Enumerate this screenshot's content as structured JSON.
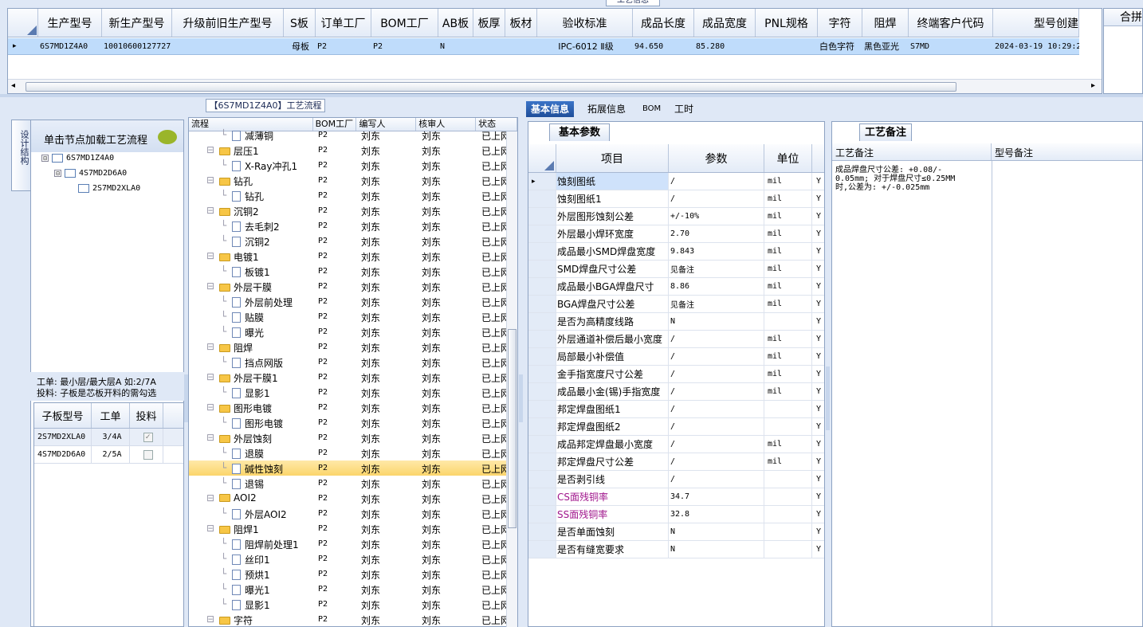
{
  "top_grid": {
    "top_label": "工艺信息",
    "columns": [
      "生产型号",
      "新生产型号",
      "升级前旧生产型号",
      "S板",
      "订单工厂",
      "BOM工厂",
      "AB板",
      "板厚",
      "板材",
      "验收标准",
      "成品长度",
      "成品宽度",
      "PNL规格",
      "字符",
      "阻焊",
      "终端客户代码",
      "型号创建"
    ],
    "row": {
      "marker": "▸",
      "cells": [
        "6S7MD1Z4A0",
        "10010600127727",
        "",
        "母板",
        "P2",
        "P2",
        "N",
        "",
        "",
        "IPC-6012 Ⅱ级",
        "94.650",
        "85.280",
        "",
        "白色字符",
        "黑色亚光",
        "S7MD",
        "2024-03-19 10:29:2"
      ]
    },
    "merge_label": "合拼"
  },
  "left": {
    "side_tab": "设计结构",
    "header": "单击节点加载工艺流程",
    "tree": [
      {
        "pm": "⊟",
        "label": "6S7MD1Z4A0"
      },
      {
        "pm": "⊟",
        "label": "4S7MD2D6A0"
      },
      {
        "pm": "",
        "label": "2S7MD2XLA0"
      }
    ],
    "note_line1": "工单: 最小层/最大层A 如:2/7A",
    "note_line2": "投料: 子板是芯板开料的需勾选",
    "subgrid": {
      "headers": [
        "子板型号",
        "工单",
        "投料"
      ],
      "rows": [
        {
          "model": "2S7MD2XLA0",
          "order": "3/4A",
          "checked": true,
          "mark": "✓"
        },
        {
          "model": "4S7MD2D6A0",
          "order": "2/5A",
          "checked": false,
          "mark": ""
        }
      ]
    }
  },
  "process": {
    "title": "【6S7MD1Z4A0】工艺流程",
    "headers": [
      "流程",
      "BOM工厂",
      "编写人",
      "核审人",
      "状态"
    ],
    "rows": [
      {
        "name": "减薄铜",
        "folder": false,
        "bom": "P2",
        "writer": "刘东",
        "reviewer": "刘东",
        "status": "已上网"
      },
      {
        "name": "层压1",
        "folder": true,
        "bom": "P2",
        "writer": "刘东",
        "reviewer": "刘东",
        "status": "已上网"
      },
      {
        "name": "X-Ray冲孔1",
        "folder": false,
        "bom": "P2",
        "writer": "刘东",
        "reviewer": "刘东",
        "status": "已上网"
      },
      {
        "name": "钻孔",
        "folder": true,
        "bom": "P2",
        "writer": "刘东",
        "reviewer": "刘东",
        "status": "已上网"
      },
      {
        "name": "钻孔",
        "folder": false,
        "bom": "P2",
        "writer": "刘东",
        "reviewer": "刘东",
        "status": "已上网"
      },
      {
        "name": "沉铜2",
        "folder": true,
        "bom": "P2",
        "writer": "刘东",
        "reviewer": "刘东",
        "status": "已上网"
      },
      {
        "name": "去毛刺2",
        "folder": false,
        "bom": "P2",
        "writer": "刘东",
        "reviewer": "刘东",
        "status": "已上网"
      },
      {
        "name": "沉铜2",
        "folder": false,
        "bom": "P2",
        "writer": "刘东",
        "reviewer": "刘东",
        "status": "已上网"
      },
      {
        "name": "电镀1",
        "folder": true,
        "bom": "P2",
        "writer": "刘东",
        "reviewer": "刘东",
        "status": "已上网"
      },
      {
        "name": "板镀1",
        "folder": false,
        "bom": "P2",
        "writer": "刘东",
        "reviewer": "刘东",
        "status": "已上网"
      },
      {
        "name": "外层干膜",
        "folder": true,
        "bom": "P2",
        "writer": "刘东",
        "reviewer": "刘东",
        "status": "已上网"
      },
      {
        "name": "外层前处理",
        "folder": false,
        "bom": "P2",
        "writer": "刘东",
        "reviewer": "刘东",
        "status": "已上网"
      },
      {
        "name": "贴膜",
        "folder": false,
        "bom": "P2",
        "writer": "刘东",
        "reviewer": "刘东",
        "status": "已上网"
      },
      {
        "name": "曝光",
        "folder": false,
        "bom": "P2",
        "writer": "刘东",
        "reviewer": "刘东",
        "status": "已上网"
      },
      {
        "name": "阻焊",
        "folder": true,
        "bom": "P2",
        "writer": "刘东",
        "reviewer": "刘东",
        "status": "已上网"
      },
      {
        "name": "挡点网版",
        "folder": false,
        "bom": "P2",
        "writer": "刘东",
        "reviewer": "刘东",
        "status": "已上网"
      },
      {
        "name": "外层干膜1",
        "folder": true,
        "bom": "P2",
        "writer": "刘东",
        "reviewer": "刘东",
        "status": "已上网"
      },
      {
        "name": "显影1",
        "folder": false,
        "bom": "P2",
        "writer": "刘东",
        "reviewer": "刘东",
        "status": "已上网"
      },
      {
        "name": "图形电镀",
        "folder": true,
        "bom": "P2",
        "writer": "刘东",
        "reviewer": "刘东",
        "status": "已上网"
      },
      {
        "name": "图形电镀",
        "folder": false,
        "bom": "P2",
        "writer": "刘东",
        "reviewer": "刘东",
        "status": "已上网"
      },
      {
        "name": "外层蚀刻",
        "folder": true,
        "bom": "P2",
        "writer": "刘东",
        "reviewer": "刘东",
        "status": "已上网"
      },
      {
        "name": "退膜",
        "folder": false,
        "bom": "P2",
        "writer": "刘东",
        "reviewer": "刘东",
        "status": "已上网"
      },
      {
        "name": "碱性蚀刻",
        "folder": false,
        "bom": "P2",
        "writer": "刘东",
        "reviewer": "刘东",
        "status": "已上网",
        "selected": true
      },
      {
        "name": "退锡",
        "folder": false,
        "bom": "P2",
        "writer": "刘东",
        "reviewer": "刘东",
        "status": "已上网"
      },
      {
        "name": "AOI2",
        "folder": true,
        "bom": "P2",
        "writer": "刘东",
        "reviewer": "刘东",
        "status": "已上网"
      },
      {
        "name": "外层AOI2",
        "folder": false,
        "bom": "P2",
        "writer": "刘东",
        "reviewer": "刘东",
        "status": "已上网"
      },
      {
        "name": "阻焊1",
        "folder": true,
        "bom": "P2",
        "writer": "刘东",
        "reviewer": "刘东",
        "status": "已上网"
      },
      {
        "name": "阻焊前处理1",
        "folder": false,
        "bom": "P2",
        "writer": "刘东",
        "reviewer": "刘东",
        "status": "已上网"
      },
      {
        "name": "丝印1",
        "folder": false,
        "bom": "P2",
        "writer": "刘东",
        "reviewer": "刘东",
        "status": "已上网"
      },
      {
        "name": "预烘1",
        "folder": false,
        "bom": "P2",
        "writer": "刘东",
        "reviewer": "刘东",
        "status": "已上网"
      },
      {
        "name": "曝光1",
        "folder": false,
        "bom": "P2",
        "writer": "刘东",
        "reviewer": "刘东",
        "status": "已上网"
      },
      {
        "name": "显影1",
        "folder": false,
        "bom": "P2",
        "writer": "刘东",
        "reviewer": "刘东",
        "status": "已上网"
      },
      {
        "name": "字符",
        "folder": true,
        "bom": "P2",
        "writer": "刘东",
        "reviewer": "刘东",
        "status": "已上网"
      }
    ]
  },
  "tabs": [
    "基本信息",
    "拓展信息",
    "BOM",
    "工时"
  ],
  "basic": {
    "subtab": "基本参数",
    "headers": [
      "项目",
      "参数",
      "单位"
    ],
    "rows": [
      {
        "item": "蚀刻图纸",
        "value": "/",
        "unit": "mil",
        "flag": "Y",
        "marker": "▸",
        "highlight": true
      },
      {
        "item": "蚀刻图纸1",
        "value": "/",
        "unit": "mil",
        "flag": "Y"
      },
      {
        "item": "外层图形蚀刻公差",
        "value": "+/-10%",
        "unit": "mil",
        "flag": "Y"
      },
      {
        "item": "外层最小焊环宽度",
        "value": "2.70",
        "unit": "mil",
        "flag": "Y"
      },
      {
        "item": "成品最小SMD焊盘宽度",
        "value": "9.843",
        "unit": "mil",
        "flag": "Y"
      },
      {
        "item": "SMD焊盘尺寸公差",
        "value": "见备注",
        "unit": "mil",
        "flag": "Y"
      },
      {
        "item": "成品最小BGA焊盘尺寸",
        "value": "8.86",
        "unit": "mil",
        "flag": "Y"
      },
      {
        "item": "BGA焊盘尺寸公差",
        "value": "见备注",
        "unit": "mil",
        "flag": "Y"
      },
      {
        "item": "是否为高精度线路",
        "value": "N",
        "unit": "",
        "flag": "Y"
      },
      {
        "item": "外层通道补偿后最小宽度",
        "value": "/",
        "unit": "mil",
        "flag": "Y"
      },
      {
        "item": "局部最小补偿值",
        "value": "/",
        "unit": "mil",
        "flag": "Y"
      },
      {
        "item": "金手指宽度尺寸公差",
        "value": "/",
        "unit": "mil",
        "flag": "Y"
      },
      {
        "item": "成品最小金(锡)手指宽度",
        "value": "/",
        "unit": "mil",
        "flag": "Y"
      },
      {
        "item": "邦定焊盘图纸1",
        "value": "/",
        "unit": "",
        "flag": "Y"
      },
      {
        "item": "邦定焊盘图纸2",
        "value": "/",
        "unit": "",
        "flag": "Y"
      },
      {
        "item": "成品邦定焊盘最小宽度",
        "value": "/",
        "unit": "mil",
        "flag": "Y"
      },
      {
        "item": "邦定焊盘尺寸公差",
        "value": "/",
        "unit": "mil",
        "flag": "Y"
      },
      {
        "item": "是否剥引线",
        "value": "/",
        "unit": "",
        "flag": "Y"
      },
      {
        "item": "CS面残铜率",
        "value": "34.7",
        "unit": "",
        "flag": "Y",
        "purple": true
      },
      {
        "item": "SS面残铜率",
        "value": "32.8",
        "unit": "",
        "flag": "Y",
        "purple": true
      },
      {
        "item": "是否单面蚀刻",
        "value": "N",
        "unit": "",
        "flag": "Y"
      },
      {
        "item": "是否有缝宽要求",
        "value": "N",
        "unit": "",
        "flag": "Y"
      }
    ]
  },
  "notes": {
    "subtab": "工艺备注",
    "col1": "工艺备注",
    "col2": "型号备注",
    "text_line1": "成品焊盘尺寸公差: +0.08/-",
    "text_line2": "0.05mm; 对于焊盘尺寸≤0.25MM",
    "text_line3": "时,公差为: +/-0.025mm"
  },
  "colors": {
    "accent": "#2a5aa8",
    "selected_row": "#fbd56b",
    "grid_select": "#bfdcfb",
    "purple_text": "#a0168c"
  }
}
